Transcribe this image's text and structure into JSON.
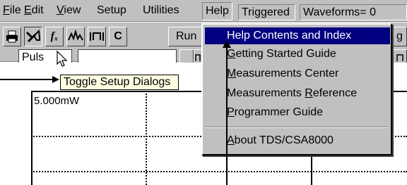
{
  "menubar": {
    "items": [
      {
        "underline": "F",
        "rest": "ile"
      },
      {
        "underline": "E",
        "rest": "dit"
      },
      {
        "underline": "V",
        "rest": "iew"
      },
      {
        "underline": "",
        "rest": "Setup"
      },
      {
        "underline": "",
        "rest": "Utilities"
      },
      {
        "underline": "",
        "rest": "Help"
      }
    ],
    "status_triggered": "Triggered",
    "status_waveforms": "Waveforms= 0"
  },
  "toolbar": {
    "fx_label": "fₓ",
    "c_label": "C",
    "run_label": "Run",
    "fragment_g": "g",
    "fragment_n": "n"
  },
  "left_field": "Puls",
  "tooltip": "Toggle Setup Dialogs",
  "help_menu": {
    "items": [
      {
        "underline": "H",
        "rest": "elp Contents and Index"
      },
      {
        "underline": "G",
        "rest": "etting Started Guide"
      },
      {
        "underline": "M",
        "rest": "easurements Center"
      },
      {
        "pre": "Measurements ",
        "underline": "R",
        "rest": "eference"
      },
      {
        "underline": "P",
        "rest": "rogrammer Guide"
      },
      {
        "underline": "A",
        "rest": "bout TDS/CSA8000"
      }
    ]
  },
  "graph": {
    "scale_label": "5.000mW"
  },
  "colors": {
    "chrome": "#c0c0c0",
    "highlight": "#000080",
    "tooltip": "#ffffe1"
  }
}
